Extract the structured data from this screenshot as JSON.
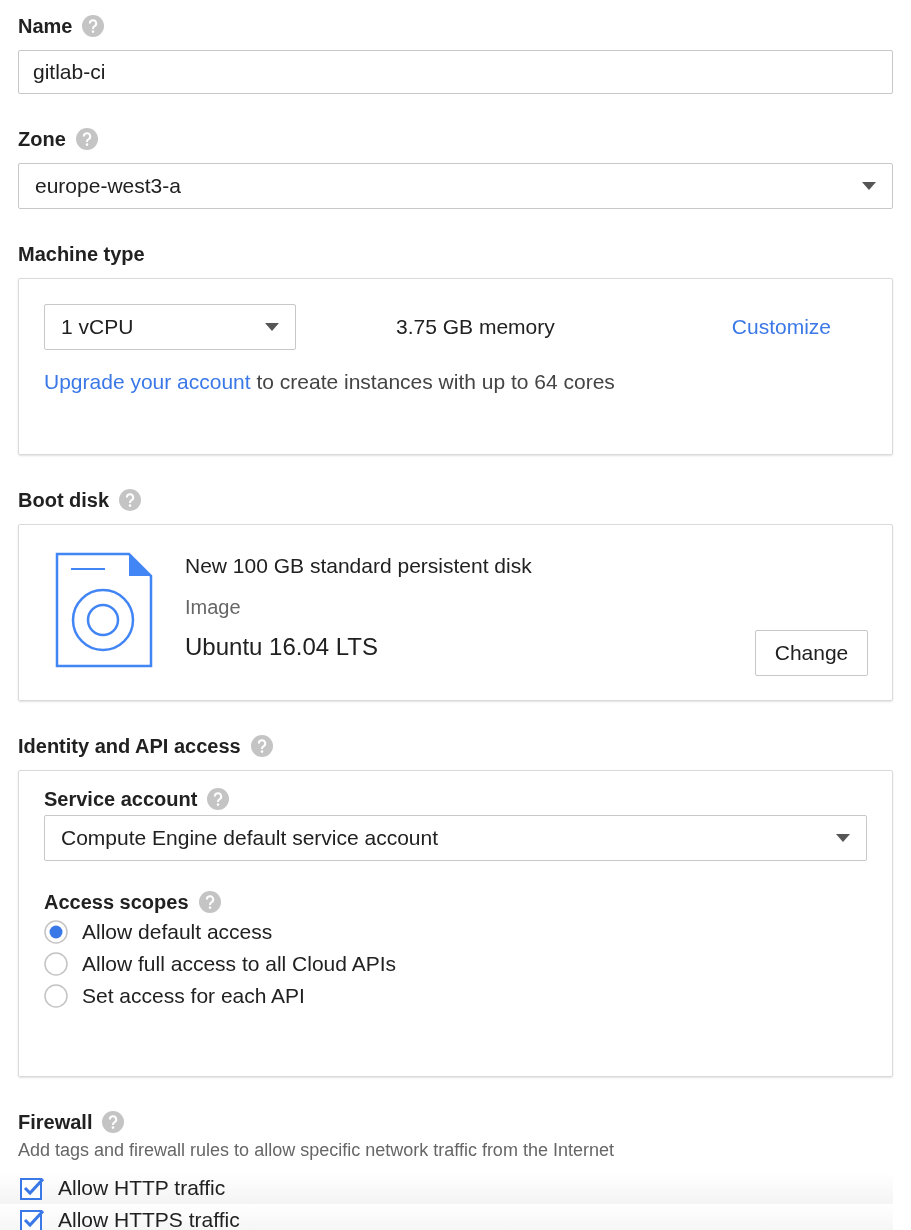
{
  "name": {
    "label": "Name",
    "help": true,
    "value": "gitlab-ci"
  },
  "zone": {
    "label": "Zone",
    "help": true,
    "value": "europe-west3-a"
  },
  "machine_type": {
    "label": "Machine type",
    "help": false,
    "cores": "1 vCPU",
    "memory": "3.75 GB memory",
    "customize": "Customize",
    "upgrade_link": "Upgrade your account",
    "upgrade_text": " to create instances with up to 64 cores"
  },
  "boot_disk": {
    "label": "Boot disk",
    "help": true,
    "title": "New 100 GB standard persistent disk",
    "image_label": "Image",
    "image": "Ubuntu 16.04 LTS",
    "change": "Change"
  },
  "identity": {
    "label": "Identity and API access",
    "help": true,
    "service_account": {
      "label": "Service account",
      "help": true,
      "value": "Compute Engine default service account"
    },
    "access_scopes": {
      "label": "Access scopes",
      "help": true,
      "options": [
        {
          "label": "Allow default access",
          "selected": true
        },
        {
          "label": "Allow full access to all Cloud APIs",
          "selected": false
        },
        {
          "label": "Set access for each API",
          "selected": false
        }
      ]
    }
  },
  "firewall": {
    "label": "Firewall",
    "help": true,
    "description": "Add tags and firewall rules to allow specific network traffic from the Internet",
    "options": [
      {
        "label": "Allow HTTP traffic",
        "checked": true
      },
      {
        "label": "Allow HTTPS traffic",
        "checked": true
      }
    ]
  }
}
